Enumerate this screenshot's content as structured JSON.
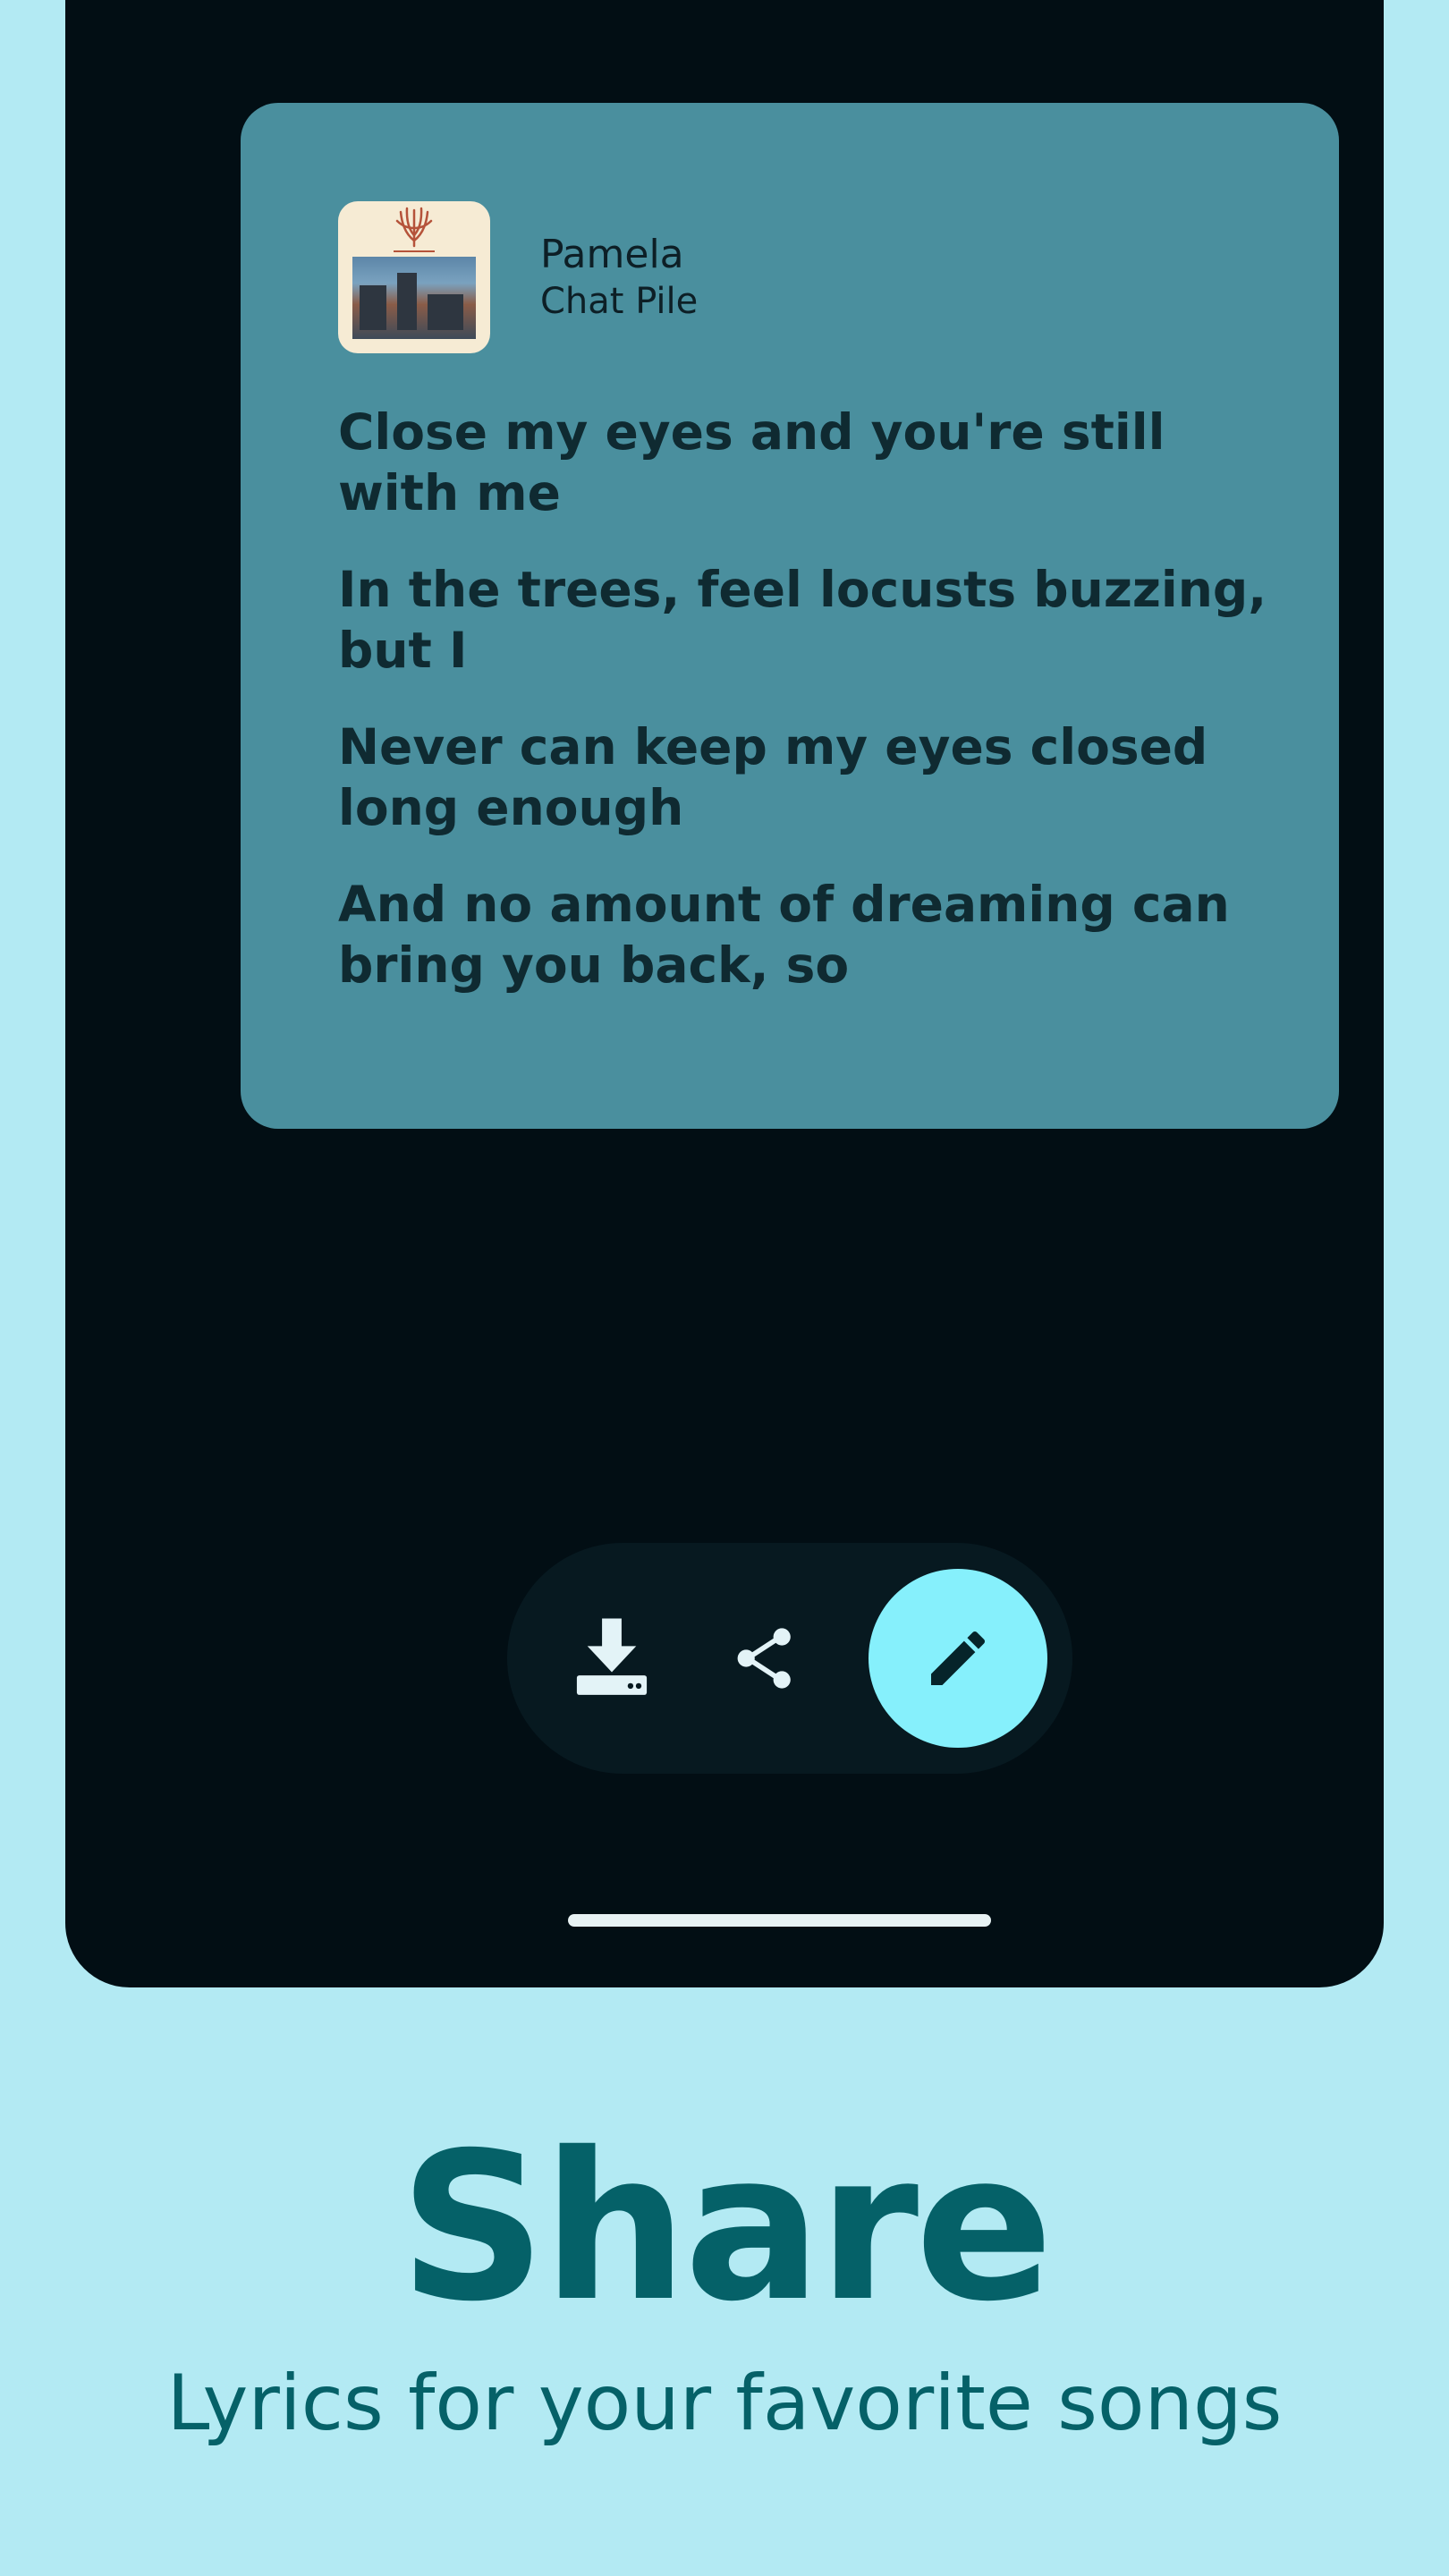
{
  "track": {
    "title": "Pamela",
    "artist": "Chat Pile",
    "album_art": "album-cover-image"
  },
  "lyrics": [
    "Close my eyes and you're still with me",
    "In the trees, feel locusts buzzing, but I",
    "Never can keep my eyes closed long enough",
    "And no amount of dreaming can bring you back, so"
  ],
  "actions": {
    "download_icon": "download-icon",
    "share_icon": "share-icon",
    "edit_icon": "pencil-icon"
  },
  "promo": {
    "headline": "Share",
    "subtitle": "Lyrics for your favorite songs"
  },
  "colors": {
    "background": "#B3EAF3",
    "screen": "#020E14",
    "card": "#4A8F9E",
    "accent": "#86F0FC",
    "headline_text": "#056168"
  }
}
